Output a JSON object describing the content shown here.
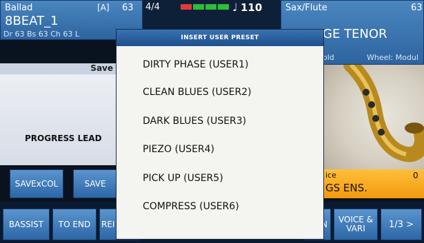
{
  "left_panel": {
    "style_name": "Ballad",
    "bank": "[A]",
    "value": "63",
    "variation": "8BEAT_1",
    "volumes": "Dr 63  Bs 63  Ch 63  L"
  },
  "tempo_panel": {
    "time_signature": "4/4",
    "tempo": "110",
    "note_symbol": "♩"
  },
  "right_panel": {
    "voice_category": "Sax/Flute",
    "value": "63",
    "voice_name_partial": "GE TENOR",
    "hold_partial": "old",
    "wheel": "Wheel: Modul"
  },
  "main": {
    "save_label": "Save",
    "progress_lead": "PROGRESS LEAD"
  },
  "buttons": {
    "save_ex_col": "SAVExCOL",
    "save": "SAVE"
  },
  "voice_box": {
    "label_partial": "ice",
    "value": "0",
    "name_partial": "GS ENS."
  },
  "bottom": {
    "bassist": "BASSIST",
    "to_end": "TO END",
    "rei": "REI",
    "n": "N",
    "voice_vari": "VOICE & VARI",
    "page": "1/3 >"
  },
  "popup": {
    "title": "INSERT USER PRESET",
    "items": [
      "DIRTY PHASE (USER1)",
      "CLEAN BLUES (USER2)",
      "DARK BLUES (USER3)",
      "PIEZO (USER4)",
      "PICK UP (USER5)",
      "COMPRESS (USER6)"
    ]
  },
  "colors": {
    "meter": [
      "#e23a3a",
      "#2bbf3a",
      "#2bbf3a",
      "#2bbf3a"
    ]
  }
}
